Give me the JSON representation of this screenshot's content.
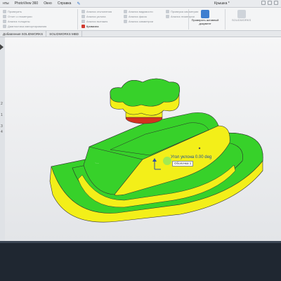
{
  "menubar": {
    "items": [
      "нты",
      "PhotoView 360",
      "Окно",
      "Справка"
    ],
    "doc_title": "Крышка *"
  },
  "ribbon": {
    "col1": [
      "Проверить",
      "Отчет о геометрии",
      "Анализ толщины",
      "Диагностика импортирования"
    ],
    "col2": [
      "Анализ отклонения",
      "Анализ уклона",
      "Анализ вытяжек",
      "Кривизна"
    ],
    "col3": [
      "Анализ видимости",
      "Анализ фасок",
      "Анализ симметрии"
    ],
    "col4": [
      "Проверка симметрии",
      "Анализ геометрии"
    ],
    "check_doc": "Проверить активный документ",
    "sim": "SOLIDWORKS",
    "active_color": "#d13a2f"
  },
  "tabs": [
    "Добавления SOLIDWORKS",
    "SOLIDWORKS MBD"
  ],
  "rail_numbers": [
    "2",
    "1",
    "3",
    "4"
  ],
  "viewport": {
    "selection_label": "Угол уклона 0.00 deg",
    "tooltip": "Оболочка 1",
    "colors": {
      "green": "#37d12a",
      "yellow": "#f3ef19",
      "red": "#d3311f"
    }
  }
}
